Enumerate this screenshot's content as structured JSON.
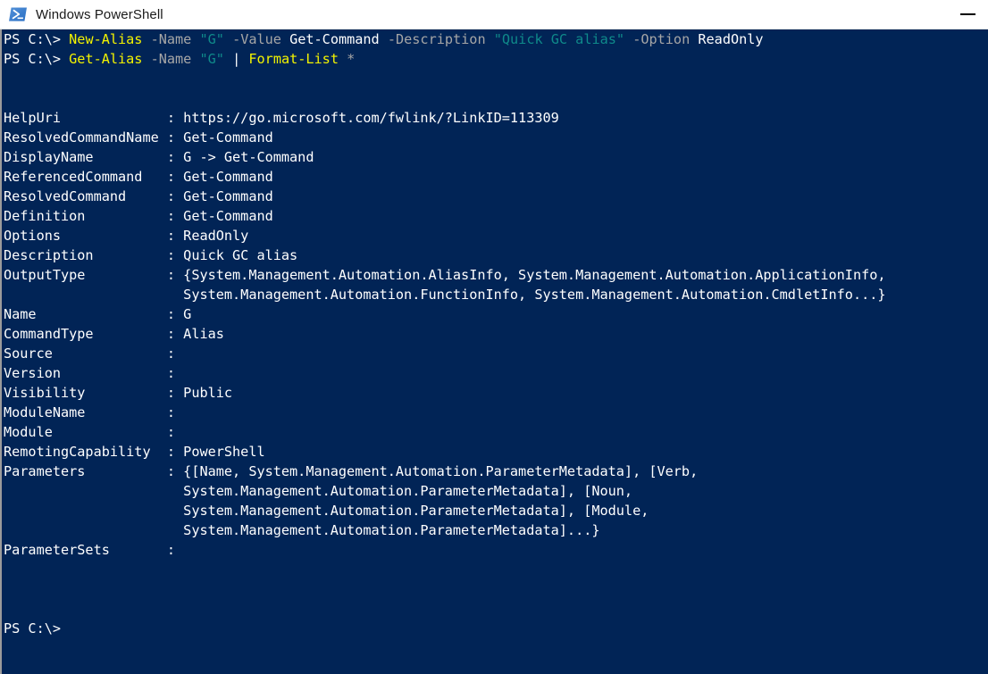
{
  "window": {
    "title": "Windows PowerShell",
    "icon": "powershell-icon",
    "background_color": "#012456",
    "titlebar_color": "#ffffff",
    "minimize_label": "–"
  },
  "console": {
    "prompt": "PS C:\\>",
    "colors": {
      "foreground": "#ffffff",
      "background": "#012456",
      "cmdlet": "#f3f300",
      "parameter": "#a6a6a6",
      "string": "#0f8a8a",
      "operator": "#a6a6a6"
    },
    "commands": [
      {
        "prompt": "PS C:\\>",
        "tokens": [
          {
            "text": "New-Alias",
            "class": "c-yellow"
          },
          {
            "text": " ",
            "class": "c-white"
          },
          {
            "text": "-Name",
            "class": "c-gray"
          },
          {
            "text": " ",
            "class": "c-white"
          },
          {
            "text": "\"G\"",
            "class": "c-teal"
          },
          {
            "text": " ",
            "class": "c-white"
          },
          {
            "text": "-Value",
            "class": "c-gray"
          },
          {
            "text": " ",
            "class": "c-white"
          },
          {
            "text": "Get-Command",
            "class": "c-white"
          },
          {
            "text": " ",
            "class": "c-white"
          },
          {
            "text": "-Description",
            "class": "c-gray"
          },
          {
            "text": " ",
            "class": "c-white"
          },
          {
            "text": "\"Quick GC alias\"",
            "class": "c-teal"
          },
          {
            "text": " ",
            "class": "c-white"
          },
          {
            "text": "-Option",
            "class": "c-gray"
          },
          {
            "text": " ",
            "class": "c-white"
          },
          {
            "text": "ReadOnly",
            "class": "c-white"
          }
        ]
      },
      {
        "prompt": "PS C:\\>",
        "tokens": [
          {
            "text": "Get-Alias",
            "class": "c-yellow"
          },
          {
            "text": " ",
            "class": "c-white"
          },
          {
            "text": "-Name",
            "class": "c-gray"
          },
          {
            "text": " ",
            "class": "c-white"
          },
          {
            "text": "\"G\"",
            "class": "c-teal"
          },
          {
            "text": " ",
            "class": "c-white"
          },
          {
            "text": "|",
            "class": "c-white"
          },
          {
            "text": " ",
            "class": "c-white"
          },
          {
            "text": "Format-List",
            "class": "c-yellow"
          },
          {
            "text": " ",
            "class": "c-white"
          },
          {
            "text": "*",
            "class": "c-gray"
          }
        ]
      }
    ],
    "output_properties": [
      {
        "name": "HelpUri",
        "value": "https://go.microsoft.com/fwlink/?LinkID=113309",
        "continuation": []
      },
      {
        "name": "ResolvedCommandName",
        "value": "Get-Command",
        "continuation": []
      },
      {
        "name": "DisplayName",
        "value": "G -> Get-Command",
        "continuation": []
      },
      {
        "name": "ReferencedCommand",
        "value": "Get-Command",
        "continuation": []
      },
      {
        "name": "ResolvedCommand",
        "value": "Get-Command",
        "continuation": []
      },
      {
        "name": "Definition",
        "value": "Get-Command",
        "continuation": []
      },
      {
        "name": "Options",
        "value": "ReadOnly",
        "continuation": []
      },
      {
        "name": "Description",
        "value": "Quick GC alias",
        "continuation": []
      },
      {
        "name": "OutputType",
        "value": "{System.Management.Automation.AliasInfo, System.Management.Automation.ApplicationInfo,",
        "continuation": [
          "System.Management.Automation.FunctionInfo, System.Management.Automation.CmdletInfo...}"
        ]
      },
      {
        "name": "Name",
        "value": "G",
        "continuation": []
      },
      {
        "name": "CommandType",
        "value": "Alias",
        "continuation": []
      },
      {
        "name": "Source",
        "value": "",
        "continuation": []
      },
      {
        "name": "Version",
        "value": "",
        "continuation": []
      },
      {
        "name": "Visibility",
        "value": "Public",
        "continuation": []
      },
      {
        "name": "ModuleName",
        "value": "",
        "continuation": []
      },
      {
        "name": "Module",
        "value": "",
        "continuation": []
      },
      {
        "name": "RemotingCapability",
        "value": "PowerShell",
        "continuation": []
      },
      {
        "name": "Parameters",
        "value": "{[Name, System.Management.Automation.ParameterMetadata], [Verb,",
        "continuation": [
          "System.Management.Automation.ParameterMetadata], [Noun,",
          "System.Management.Automation.ParameterMetadata], [Module,",
          "System.Management.Automation.ParameterMetadata]...}"
        ]
      },
      {
        "name": "ParameterSets",
        "value": "",
        "continuation": []
      }
    ],
    "trailing_prompt": "PS C:\\>"
  }
}
